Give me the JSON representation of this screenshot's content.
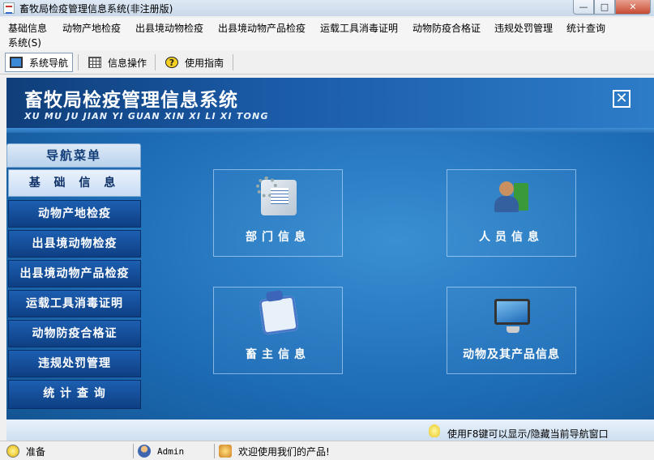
{
  "window": {
    "title": "畜牧局检疫管理信息系统(非注册版)",
    "minimize_glyph": "—",
    "maximize_glyph": "□",
    "close_glyph": "✕"
  },
  "menu": {
    "items": [
      "基础信息",
      "动物产地检疫",
      "出县境动物检疫",
      "出县境动物产品检疫",
      "运载工具消毒证明",
      "动物防疫合格证",
      "违规处罚管理",
      "统计查询",
      "系统(S)"
    ]
  },
  "toolbar": {
    "items": [
      {
        "label": "系统导航",
        "icon": "navigation-icon",
        "active": true
      },
      {
        "label": "信息操作",
        "icon": "grid-icon",
        "active": false
      },
      {
        "label": "使用指南",
        "icon": "help-icon",
        "active": false
      }
    ],
    "help_glyph": "?"
  },
  "banner": {
    "title": "畜牧局检疫管理信息系统",
    "subtitle": "XU MU JU JIAN YI GUAN  XIN XI LI XI TONG",
    "close_glyph": "✕"
  },
  "nav": {
    "header": "导航菜单",
    "items": [
      {
        "label": "基 础 信 息",
        "selected": true
      },
      {
        "label": "动物产地检疫",
        "selected": false
      },
      {
        "label": "出县境动物检疫",
        "selected": false
      },
      {
        "label": "出县境动物产品检疫",
        "selected": false
      },
      {
        "label": "运载工具消毒证明",
        "selected": false
      },
      {
        "label": "动物防疫合格证",
        "selected": false
      },
      {
        "label": "违规处罚管理",
        "selected": false
      },
      {
        "label": "统 计 查 询",
        "selected": false
      }
    ]
  },
  "tiles": [
    {
      "label": "部门信息",
      "icon": "department-icon"
    },
    {
      "label": "人员信息",
      "icon": "person-icon"
    },
    {
      "label": "畜主信息",
      "icon": "owner-icon"
    },
    {
      "label": "动物及其产品信息",
      "icon": "monitor-icon"
    }
  ],
  "hint": {
    "text": "使用F8键可以显示/隐藏当前导航窗口",
    "icon": "lightbulb-icon"
  },
  "status": {
    "state": "准备",
    "user": "Admin",
    "message": "欢迎使用我们的产品!"
  },
  "colors": {
    "nav_button": "#0e3f83",
    "panel_bg": "#1d6cb6",
    "banner_bg": "#0f3e7a"
  }
}
